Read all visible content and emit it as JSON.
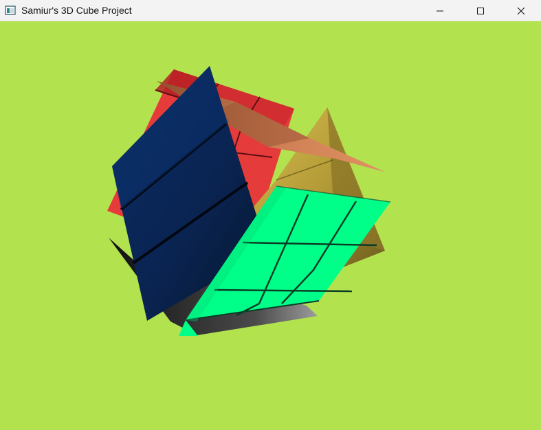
{
  "window": {
    "title": "Samiur's 3D Cube Project",
    "icon": "app-window-icon",
    "controls": [
      "minimize-icon",
      "maximize-icon",
      "close-icon"
    ]
  },
  "scene": {
    "background_color": "#b2e34f",
    "objects": [
      {
        "name": "red-face",
        "color": "#e53035"
      },
      {
        "name": "gold-pyramid",
        "color": "#b9a33b"
      },
      {
        "name": "orange-spike",
        "color": "#c8754b"
      },
      {
        "name": "navy-face",
        "color": "#0b2a5a"
      },
      {
        "name": "green-face",
        "color": "#00ff88"
      },
      {
        "name": "dark-base",
        "color": "#1c1c1c"
      }
    ]
  }
}
